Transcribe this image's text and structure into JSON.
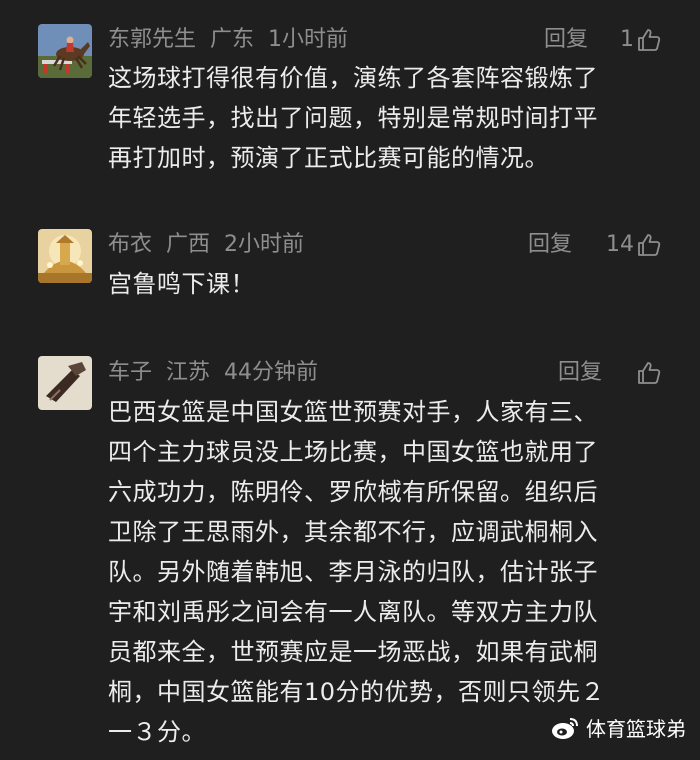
{
  "comments": [
    {
      "username": "东郭先生",
      "location": "广东",
      "time": "1小时前",
      "reply_label": "回复",
      "likes": "1",
      "text": "这场球打得很有价值，演练了各套阵容锻炼了\n年轻选手，找出了问题，特别是常规时间打平\n再打加时，预演了正式比赛可能的情况。"
    },
    {
      "username": "布衣",
      "location": "广西",
      "time": "2小时前",
      "reply_label": "回复",
      "likes": "14",
      "text": "宫鲁鸣下课！"
    },
    {
      "username": "车子",
      "location": "江苏",
      "time": "44分钟前",
      "reply_label": "回复",
      "likes": "",
      "text": "巴西女篮是中国女篮世预赛对手，人家有三、\n四个主力球员没上场比赛，中国女篮也就用了\n六成功力，陈明伶、罗欣棫有所保留。组织后\n卫除了王思雨外，其余都不行，应调武桐桐入\n队。另外随着韩旭、李月泳的归队，估计张子\n宇和刘禹彤之间会有一人离队。等双方主力队\n员都来全，世预赛应是一场恶战，如果有武桐\n桐，中国女篮能有10分的优势，否则只领先２\n一３分。"
    }
  ],
  "watermark": {
    "text": "体育篮球弟",
    "icon": "weibo-icon"
  },
  "colors": {
    "background": "#1f1f1f",
    "meta_text": "#8e8e8e",
    "body_text": "#ececec"
  }
}
